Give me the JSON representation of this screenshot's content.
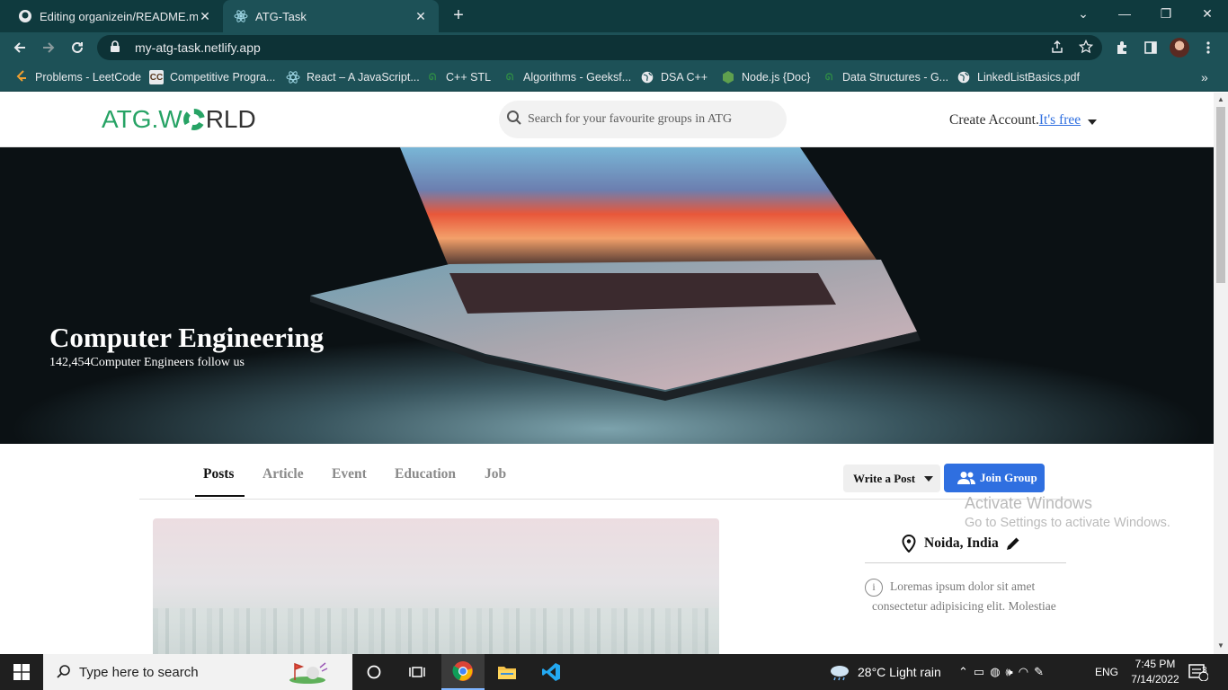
{
  "browser": {
    "tabs": [
      {
        "title": "Editing organizein/README.md a",
        "favicon": "github-icon"
      },
      {
        "title": "ATG-Task",
        "favicon": "react-icon"
      }
    ],
    "url": "my-atg-task.netlify.app",
    "bookmarks": [
      {
        "label": "Problems - LeetCode",
        "icon": "leetcode-icon"
      },
      {
        "label": "Competitive Progra...",
        "icon": "cc-icon"
      },
      {
        "label": "React – A JavaScript...",
        "icon": "react-icon"
      },
      {
        "label": "C++ STL",
        "icon": "gfg-icon"
      },
      {
        "label": "Algorithms - Geeksf...",
        "icon": "gfg-icon"
      },
      {
        "label": "DSA C++",
        "icon": "globe-icon"
      },
      {
        "label": "Node.js {Doc}",
        "icon": "nodejs-icon"
      },
      {
        "label": "Data Structures - G...",
        "icon": "gfg-icon"
      },
      {
        "label": "LinkedListBasics.pdf",
        "icon": "globe-icon"
      }
    ]
  },
  "header": {
    "logo_left": "ATG.W",
    "logo_right": "RLD",
    "search_placeholder": "Search for your favourite groups in ATG",
    "create_account": "Create Account.",
    "its_free": "It's free"
  },
  "hero": {
    "title": "Computer Engineering",
    "subtitle": "142,454Computer Engineers follow us"
  },
  "tabs": {
    "items": [
      "Posts",
      "Article",
      "Event",
      "Education",
      "Job"
    ],
    "active": "Posts",
    "write_post": "Write a Post",
    "join_group": "Join Group"
  },
  "sidebar": {
    "location": "Noida, India",
    "info_line1": "Loremas ipsum dolor sit amet",
    "info_line2": "consectetur adipisicing elit. Molestiae"
  },
  "watermark": {
    "line1": "Activate Windows",
    "line2": "Go to Settings to activate Windows."
  },
  "taskbar": {
    "search_placeholder": "Type here to search",
    "weather": "28°C  Light rain",
    "lang": "ENG",
    "time": "7:45 PM",
    "date": "7/14/2022",
    "notifications": "3"
  },
  "colors": {
    "accent_green": "#27a365",
    "join_blue": "#2f6fe0",
    "chrome_dark": "#0f3a3e",
    "chrome_toolbar": "#1d5157"
  }
}
